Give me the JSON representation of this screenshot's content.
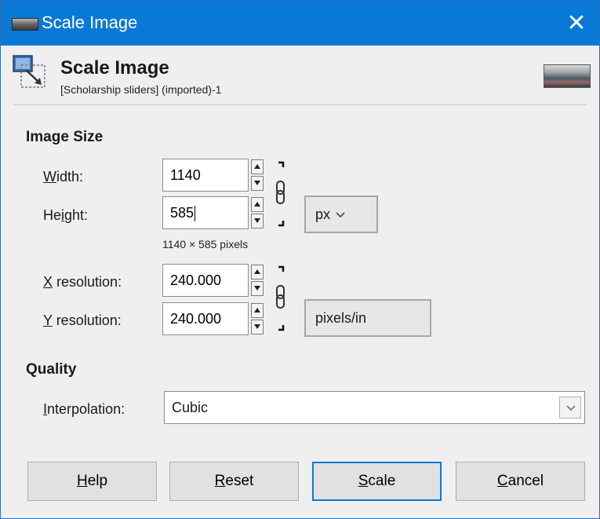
{
  "window": {
    "title": "Scale Image"
  },
  "header": {
    "title": "Scale Image",
    "subtitle": "[Scholarship sliders] (imported)-1"
  },
  "image_size": {
    "heading": "Image Size",
    "width": {
      "label_accel": "W",
      "label_rest": "idth:",
      "value": "1140"
    },
    "height": {
      "label_pre": "He",
      "label_accel": "i",
      "label_rest": "ght:",
      "value": "585"
    },
    "size_unit": "px",
    "pixels_info": "1140 × 585 pixels",
    "x_resolution": {
      "label_accel": "X",
      "label_rest": " resolution:",
      "value": "240.000"
    },
    "y_resolution": {
      "label_accel": "Y",
      "label_rest": " resolution:",
      "value": "240.000"
    },
    "resolution_unit": "pixels/in"
  },
  "quality": {
    "heading": "Quality",
    "interpolation": {
      "label_accel": "I",
      "label_rest": "nterpolation:",
      "value": "Cubic"
    }
  },
  "buttons": {
    "help": {
      "accel": "H",
      "rest": "elp"
    },
    "reset": {
      "accel": "R",
      "rest": "eset"
    },
    "scale": {
      "accel": "S",
      "rest": "cale"
    },
    "cancel": {
      "accel": "C",
      "rest": "ancel"
    }
  },
  "colors": {
    "titlebar": "#0a78d7",
    "default_button_border": "#0a78d7"
  },
  "icons": [
    "app-icon",
    "scale-image-icon",
    "image-thumbnail",
    "close-icon",
    "spin-up-icon",
    "spin-down-icon",
    "chain-link-icon",
    "chevron-down-icon"
  ]
}
